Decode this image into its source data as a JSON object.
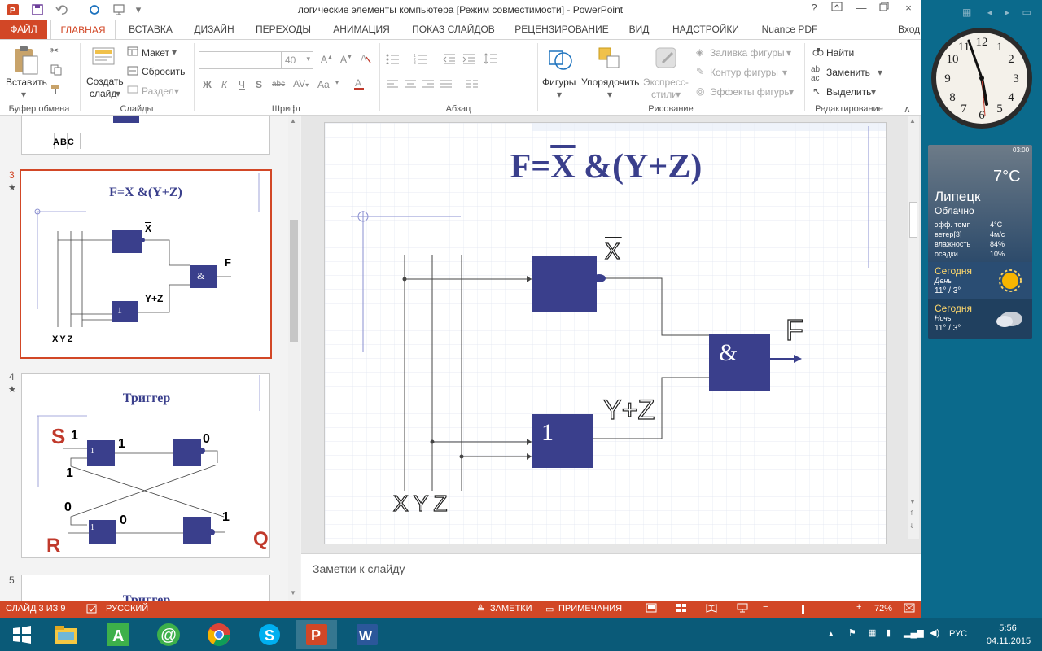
{
  "window": {
    "title": "логические элементы компьютера [Режим совместимости] - PowerPoint",
    "controls": [
      "?",
      "—",
      "×"
    ]
  },
  "tabs": [
    "ФАЙЛ",
    "ГЛАВНАЯ",
    "ВСТАВКА",
    "ДИЗАЙН",
    "ПЕРЕХОДЫ",
    "АНИМАЦИЯ",
    "ПОКАЗ СЛАЙДОВ",
    "РЕЦЕНЗИРОВАНИЕ",
    "ВИД",
    "НАДСТРОЙКИ",
    "Nuance PDF"
  ],
  "signin": "Вход",
  "ribbon": {
    "clipboard": {
      "paste": "Вставить",
      "label": "Буфер обмена"
    },
    "slides": {
      "new_slide_1": "Создать",
      "new_slide_2": "слайд",
      "layout": "Макет",
      "reset": "Сбросить",
      "section": "Раздел",
      "label": "Слайды"
    },
    "font": {
      "size": "40",
      "bold": "Ж",
      "italic": "К",
      "underline": "Ч",
      "strike": "S",
      "spacing": "abc",
      "case": "Aa",
      "label": "Шрифт"
    },
    "paragraph": {
      "label": "Абзац"
    },
    "drawing": {
      "shapes": "Фигуры",
      "arrange": "Упорядочить",
      "styles_1": "Экспресс-",
      "styles_2": "стили",
      "fill": "Заливка фигуры",
      "outline": "Контур фигуры",
      "effects": "Эффекты фигуры",
      "label": "Рисование"
    },
    "editing": {
      "find": "Найти",
      "replace": "Заменить",
      "select": "Выделить",
      "label": "Редактирование"
    }
  },
  "thumbnails": {
    "numbers": [
      "3",
      "4",
      "5"
    ],
    "star": "★",
    "slide2_label": "ABC",
    "slide3": {
      "title": "F=X &(Y+Z)",
      "x": "X",
      "f": "F",
      "amp": "&",
      "one": "1",
      "yz": "Y+Z",
      "xyz": "XYZ"
    },
    "slide4": {
      "title": "Триггер",
      "s": "S",
      "r": "R",
      "q": "Q",
      "one": "1",
      "zero": "0"
    },
    "slide5": {
      "title": "Триггер"
    }
  },
  "slide": {
    "title_f": "F=",
    "title_x": "X",
    "title_rest": " &(Y+Z)",
    "not_label": "X",
    "and_symbol": "&",
    "or_symbol": "1",
    "f_label": "F",
    "yz_label": "Y+Z",
    "inputs": [
      "X",
      "Y",
      "Z"
    ]
  },
  "notes": {
    "placeholder": "Заметки к слайду"
  },
  "status": {
    "slide_info": "СЛАЙД 3 ИЗ 9",
    "language": "РУССКИЙ",
    "notes": "ЗАМЕТКИ",
    "comments": "ПРИМЕЧАНИЯ",
    "zoom": "72%",
    "zoom_level": 0.72
  },
  "taskbar": {
    "apps": [
      "start",
      "file-explorer",
      "app-a",
      "mail-agent",
      "chrome",
      "skype",
      "powerpoint",
      "word"
    ],
    "lang": "РУС",
    "time": "5:56",
    "date": "04.11.2015"
  },
  "weather": {
    "time": "03:00",
    "temp": "7°C",
    "city": "Липецк",
    "condition": "Облачно",
    "rows": [
      {
        "k": "эфф. темп",
        "v": "4°C"
      },
      {
        "k": "ветер[3]",
        "v": "4м/с"
      },
      {
        "k": "влажность",
        "v": "84%"
      },
      {
        "k": "осадки",
        "v": "10%"
      }
    ],
    "today": "Сегодня",
    "day": "День",
    "day_temp": "11° /  3°",
    "tonight": "Сегодня",
    "night": "Ночь",
    "night_temp": "11° /  3°"
  },
  "colors": {
    "accent": "#d24726",
    "gate": "#3a3f8c",
    "taskbar": "#0a5a78"
  }
}
